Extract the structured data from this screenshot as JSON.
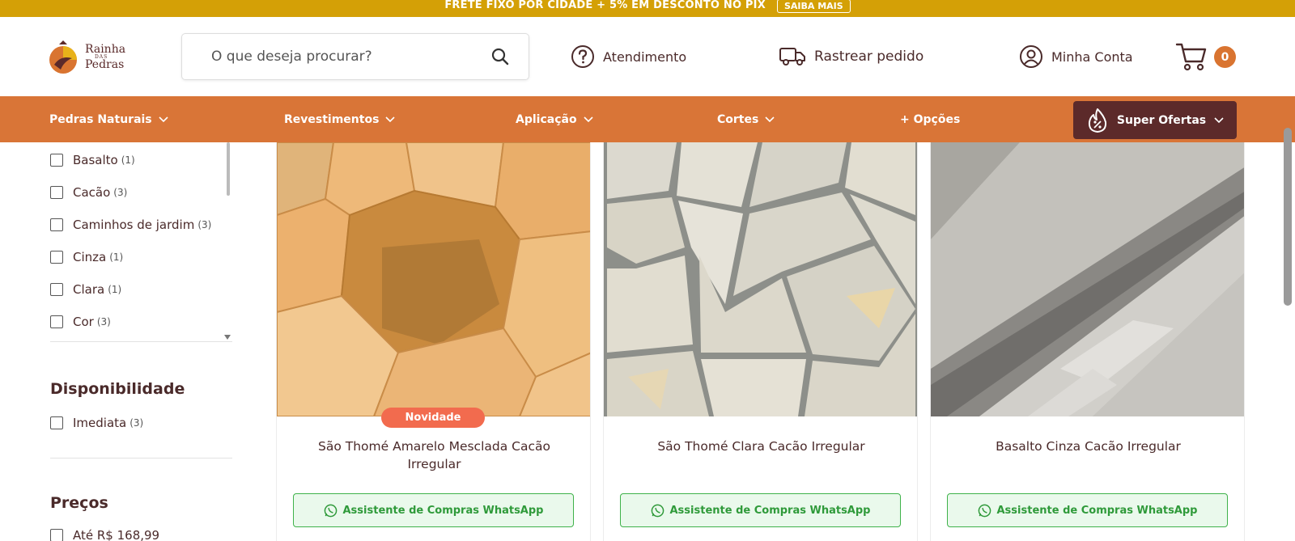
{
  "promo": {
    "text": "FRETE FIXO POR CIDADE + 5% EM DESCONTO NO PIX",
    "button": "SAIBA MAIS"
  },
  "header": {
    "logo_top": "Rainha",
    "logo_small": "DAS",
    "logo_bottom": "Pedras",
    "search_placeholder": "O que deseja procurar?",
    "support": "Atendimento",
    "track": "Rastrear pedido",
    "account": "Minha Conta",
    "cart_count": "0"
  },
  "nav": {
    "items": [
      {
        "label": "Pedras Naturais"
      },
      {
        "label": "Revestimentos"
      },
      {
        "label": "Aplicação"
      },
      {
        "label": "Cortes"
      },
      {
        "label": "+ Opções"
      }
    ],
    "super": "Super Ofertas"
  },
  "sidebar": {
    "filters": [
      {
        "label": "Basalto",
        "count": "(1)"
      },
      {
        "label": "Cacão",
        "count": "(3)"
      },
      {
        "label": "Caminhos de jardim",
        "count": "(3)"
      },
      {
        "label": "Cinza",
        "count": "(1)"
      },
      {
        "label": "Clara",
        "count": "(1)"
      },
      {
        "label": "Cor",
        "count": "(3)"
      }
    ],
    "availability_title": "Disponibilidade",
    "availability": {
      "label": "Imediata",
      "count": "(3)"
    },
    "prices_title": "Preços",
    "price_first": "Até R$ 168,99"
  },
  "products": [
    {
      "title": "São Thomé Amarelo Mesclada Cacão Irregular",
      "tag": "Novidade",
      "button": "Assistente de Compras WhatsApp"
    },
    {
      "title": "São Thomé Clara Cacão Irregular",
      "button": "Assistente de Compras WhatsApp"
    },
    {
      "title": "Basalto Cinza Cacão Irregular",
      "button": "Assistente de Compras WhatsApp"
    }
  ],
  "colors": {
    "promo": "#d4a006",
    "nav": "#d97537",
    "super_offers": "#5c2a2a",
    "badge": "#d97430",
    "tag": "#f26b4e",
    "whatsapp": "#3fb24a"
  }
}
